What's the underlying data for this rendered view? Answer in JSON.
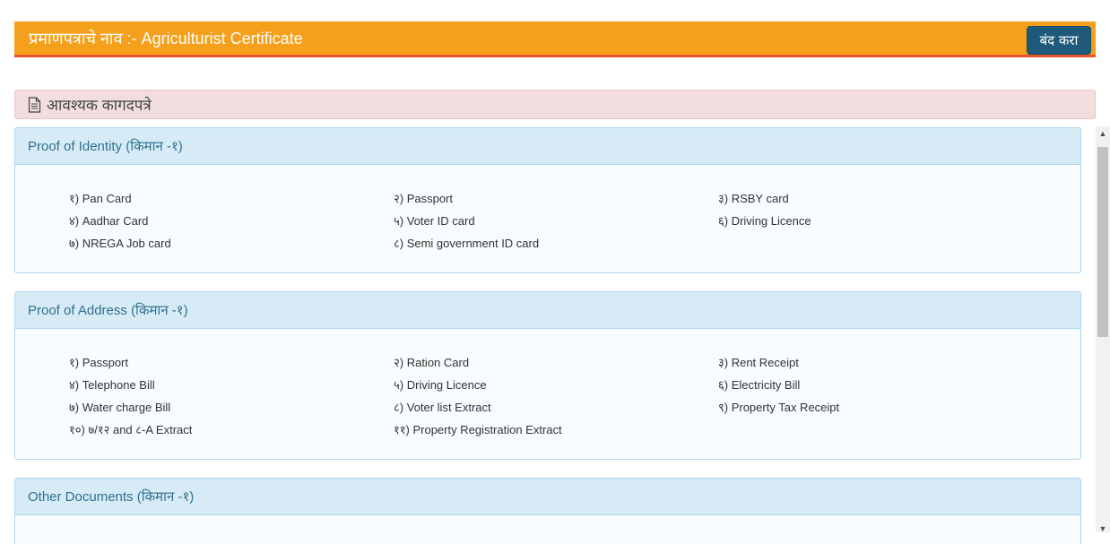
{
  "modal": {
    "title": "प्रमाणपत्राचे नाव :- Agriculturist Certificate",
    "close_label": "बंद करा"
  },
  "docs_alert": {
    "label": "आवश्यक कागदपत्रे",
    "icon": "document-icon"
  },
  "sections": [
    {
      "heading": "Proof of Identity (किमान -१)",
      "items": [
        "१) Pan Card",
        "२) Passport",
        "३) RSBY card",
        "४) Aadhar Card",
        "५) Voter ID card",
        "६) Driving Licence",
        "७) NREGA Job card",
        "८) Semi government ID card"
      ]
    },
    {
      "heading": "Proof of Address (किमान -१)",
      "items": [
        "१) Passport",
        "२) Ration Card",
        "३) Rent Receipt",
        "४) Telephone Bill",
        "५) Driving Licence",
        "६) Electricity Bill",
        "७) Water charge Bill",
        "८) Voter list Extract",
        "९) Property Tax Receipt",
        "१०) ७/१२ and ८-A Extract",
        "११) Property Registration Extract"
      ]
    },
    {
      "heading": "Other Documents (किमान -१)",
      "items": []
    }
  ],
  "colors": {
    "header_bg": "#f4a01c",
    "header_border": "#e8552a",
    "close_button": "#1f5a7a",
    "alert_bg": "#f2dede",
    "panel_heading_bg": "#d6ebf6",
    "panel_heading_text": "#31708f"
  }
}
